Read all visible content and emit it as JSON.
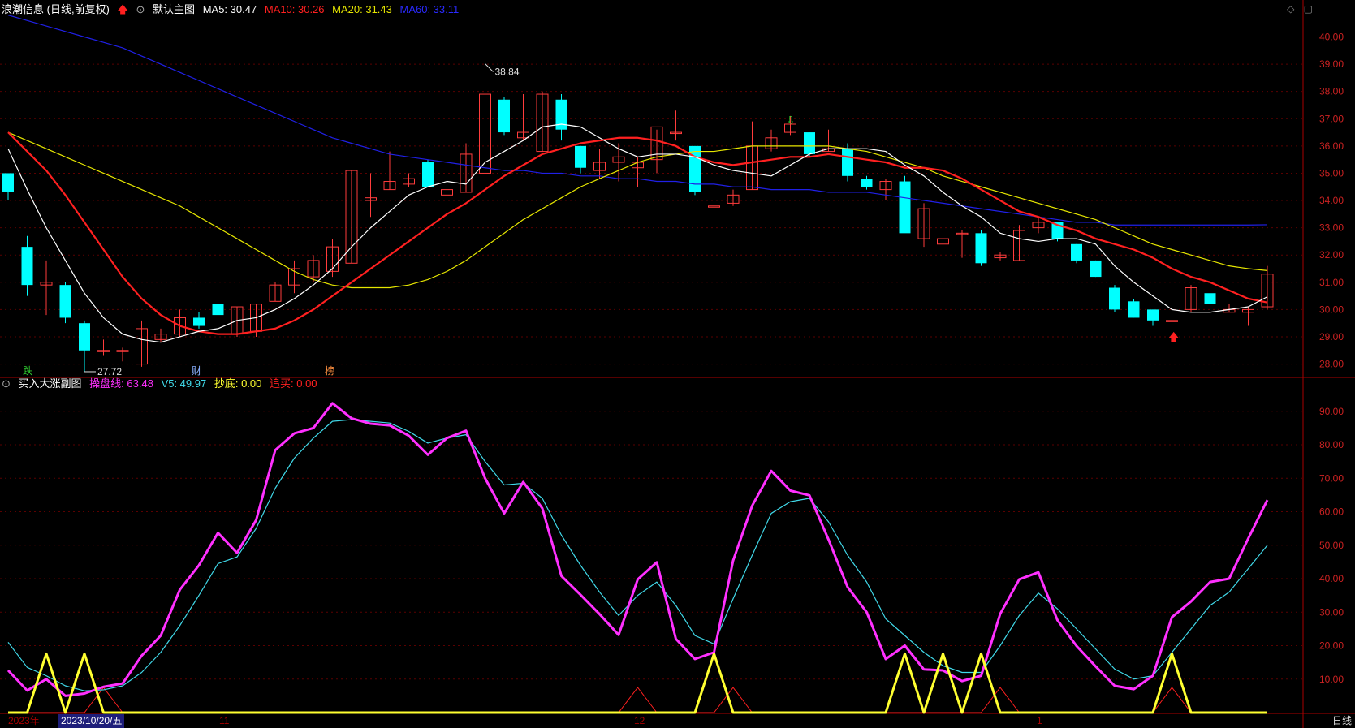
{
  "header": {
    "stock_title": "浪潮信息 (日线,前复权)",
    "main_chart_label": "默认主图",
    "ma5": "MA5: 30.47",
    "ma10": "MA10: 30.26",
    "ma20": "MA20: 31.43",
    "ma60": "MA60: 33.11"
  },
  "sub_header": {
    "title": "买入大涨副图",
    "pan": "操盘线: 63.48",
    "v5": "V5: 49.97",
    "chaodi": "抄底: 0.00",
    "zhuimai": "追买: 0.00"
  },
  "markers": {
    "die": "跌",
    "cai": "财",
    "bang": "榜"
  },
  "annotations": {
    "high": "38.84",
    "low": "27.72"
  },
  "x_axis": {
    "year": "2023年",
    "selected_date": "2023/10/20/五",
    "m11": "11",
    "m12": "12",
    "m1": "1"
  },
  "period_button": "日线",
  "colors": {
    "up": "#ff3c3c",
    "down": "#00ffff",
    "ma5": "#ffffff",
    "ma10": "#ff2020",
    "ma20": "#e6e600",
    "ma60": "#2020e6",
    "pan": "#ff30ff",
    "v5": "#40d8e8",
    "chaodi": "#ffff30",
    "zhuimai": "#ff2020",
    "axis": "#aa0000"
  },
  "chart_data": [
    {
      "type": "candlestick",
      "ylim": [
        27.6,
        40.7
      ],
      "yticks": [
        "28.00",
        "29.00",
        "30.00",
        "31.00",
        "32.00",
        "33.00",
        "34.00",
        "35.00",
        "36.00",
        "37.00",
        "38.00",
        "39.00",
        "40.00"
      ],
      "ohlc": [
        [
          35.0,
          35.0,
          34.0,
          34.3
        ],
        [
          32.3,
          32.7,
          30.5,
          30.9
        ],
        [
          30.9,
          31.8,
          29.8,
          31.0
        ],
        [
          30.9,
          31.0,
          29.5,
          29.7
        ],
        [
          29.5,
          29.6,
          27.72,
          28.5
        ],
        [
          28.5,
          28.9,
          28.3,
          28.5
        ],
        [
          28.5,
          28.6,
          28.1,
          28.5
        ],
        [
          28.0,
          29.6,
          27.9,
          29.3
        ],
        [
          28.9,
          29.3,
          28.8,
          29.1
        ],
        [
          29.1,
          30.0,
          29.0,
          29.7
        ],
        [
          29.7,
          29.9,
          29.3,
          29.4
        ],
        [
          30.2,
          30.9,
          29.8,
          29.8
        ],
        [
          29.1,
          30.1,
          29.0,
          30.1
        ],
        [
          29.2,
          30.2,
          29.0,
          30.2
        ],
        [
          30.3,
          31.0,
          30.3,
          30.9
        ],
        [
          30.9,
          31.8,
          30.6,
          31.5
        ],
        [
          31.2,
          32.0,
          31.0,
          31.8
        ],
        [
          31.4,
          32.6,
          31.2,
          32.3
        ],
        [
          31.7,
          35.1,
          31.7,
          35.1
        ],
        [
          34.0,
          35.0,
          33.4,
          34.1
        ],
        [
          34.4,
          35.8,
          34.4,
          34.7
        ],
        [
          34.6,
          35.0,
          34.5,
          34.8
        ],
        [
          35.4,
          35.5,
          34.5,
          34.5
        ],
        [
          34.2,
          34.3,
          34.1,
          34.4
        ],
        [
          34.3,
          36.1,
          34.3,
          35.7
        ],
        [
          35.0,
          38.84,
          34.8,
          37.9
        ],
        [
          37.7,
          37.8,
          36.4,
          36.5
        ],
        [
          36.3,
          37.9,
          36.2,
          36.5
        ],
        [
          35.8,
          38.0,
          35.8,
          37.9
        ],
        [
          37.7,
          37.9,
          36.2,
          36.6
        ],
        [
          36.0,
          36.0,
          35.0,
          35.2
        ],
        [
          35.1,
          35.9,
          34.8,
          35.4
        ],
        [
          35.4,
          36.1,
          34.7,
          35.6
        ],
        [
          35.2,
          35.6,
          34.5,
          35.4
        ],
        [
          35.5,
          36.6,
          35.0,
          36.7
        ],
        [
          36.5,
          37.3,
          36.2,
          36.5
        ],
        [
          36.0,
          36.0,
          34.2,
          34.3
        ],
        [
          33.8,
          34.4,
          33.5,
          33.8
        ],
        [
          33.9,
          34.4,
          33.8,
          34.2
        ],
        [
          34.4,
          36.9,
          34.4,
          36.0
        ],
        [
          35.9,
          36.6,
          35.8,
          36.3
        ],
        [
          36.5,
          37.1,
          36.4,
          36.8
        ],
        [
          36.5,
          36.5,
          35.6,
          35.7
        ],
        [
          35.8,
          36.6,
          35.8,
          35.9
        ],
        [
          35.9,
          36.1,
          34.7,
          34.9
        ],
        [
          34.8,
          34.9,
          34.4,
          34.5
        ],
        [
          34.4,
          34.8,
          34.0,
          34.7
        ],
        [
          34.7,
          34.9,
          32.9,
          32.8
        ],
        [
          32.6,
          33.9,
          32.3,
          33.7
        ],
        [
          32.4,
          33.8,
          32.3,
          32.6
        ],
        [
          32.8,
          32.9,
          31.9,
          32.8
        ],
        [
          32.8,
          32.9,
          31.6,
          31.7
        ],
        [
          31.9,
          32.1,
          31.8,
          32.0
        ],
        [
          31.8,
          33.1,
          31.8,
          32.9
        ],
        [
          33.0,
          33.4,
          32.8,
          33.2
        ],
        [
          33.2,
          33.2,
          32.5,
          32.6
        ],
        [
          32.4,
          32.4,
          31.7,
          31.8
        ],
        [
          31.8,
          31.8,
          31.2,
          31.2
        ],
        [
          30.8,
          30.9,
          29.9,
          30.0
        ],
        [
          30.3,
          30.4,
          29.7,
          29.7
        ],
        [
          30.0,
          30.0,
          29.4,
          29.6
        ],
        [
          29.6,
          29.7,
          28.8,
          29.6
        ],
        [
          30.0,
          30.9,
          29.9,
          30.8
        ],
        [
          30.6,
          31.6,
          30.1,
          30.2
        ],
        [
          29.9,
          30.2,
          29.9,
          30.0
        ],
        [
          29.9,
          30.1,
          29.4,
          30.0
        ],
        [
          30.1,
          31.6,
          30.0,
          31.3
        ]
      ],
      "ma5": [
        35.9,
        34.4,
        33.0,
        31.8,
        30.6,
        29.7,
        29.1,
        28.9,
        28.8,
        29.0,
        29.2,
        29.3,
        29.6,
        29.7,
        30.0,
        30.4,
        30.9,
        31.5,
        32.3,
        33.0,
        33.6,
        34.2,
        34.5,
        34.7,
        34.6,
        35.4,
        35.8,
        36.2,
        36.7,
        36.8,
        36.7,
        36.3,
        35.9,
        35.6,
        35.7,
        35.7,
        35.6,
        35.3,
        35.1,
        35.0,
        34.9,
        35.3,
        35.7,
        35.9,
        35.9,
        35.9,
        35.8,
        35.3,
        34.9,
        34.3,
        33.8,
        33.4,
        32.8,
        32.6,
        32.5,
        32.6,
        32.6,
        32.4,
        31.6,
        31.0,
        30.5,
        30.0,
        29.9,
        29.9,
        30.0,
        30.1,
        30.47
      ],
      "ma10": [
        36.5,
        35.8,
        35.1,
        34.2,
        33.2,
        32.2,
        31.2,
        30.4,
        29.8,
        29.4,
        29.2,
        29.1,
        29.1,
        29.2,
        29.3,
        29.6,
        30.0,
        30.5,
        31.0,
        31.5,
        32.0,
        32.5,
        33.0,
        33.5,
        33.9,
        34.4,
        34.9,
        35.3,
        35.7,
        35.9,
        36.1,
        36.2,
        36.3,
        36.3,
        36.2,
        36.0,
        35.6,
        35.4,
        35.3,
        35.4,
        35.5,
        35.6,
        35.6,
        35.7,
        35.6,
        35.5,
        35.4,
        35.2,
        35.2,
        35.1,
        34.8,
        34.4,
        34.0,
        33.6,
        33.4,
        33.1,
        32.9,
        32.6,
        32.4,
        32.2,
        31.9,
        31.5,
        31.2,
        31.0,
        30.7,
        30.4,
        30.26
      ],
      "ma20": [
        36.5,
        36.2,
        35.9,
        35.6,
        35.3,
        35.0,
        34.7,
        34.4,
        34.1,
        33.8,
        33.4,
        33.0,
        32.6,
        32.2,
        31.8,
        31.4,
        31.1,
        30.9,
        30.8,
        30.8,
        30.8,
        30.9,
        31.1,
        31.4,
        31.8,
        32.3,
        32.8,
        33.3,
        33.7,
        34.1,
        34.5,
        34.8,
        35.1,
        35.4,
        35.6,
        35.7,
        35.8,
        35.8,
        35.9,
        36.0,
        36.0,
        36.0,
        36.0,
        36.0,
        35.9,
        35.8,
        35.6,
        35.4,
        35.2,
        34.9,
        34.7,
        34.5,
        34.3,
        34.1,
        33.9,
        33.7,
        33.5,
        33.3,
        33.0,
        32.7,
        32.4,
        32.2,
        32.0,
        31.8,
        31.6,
        31.5,
        31.43
      ],
      "ma60": [
        40.8,
        40.6,
        40.4,
        40.2,
        40.0,
        39.8,
        39.6,
        39.3,
        39.0,
        38.7,
        38.4,
        38.1,
        37.8,
        37.5,
        37.2,
        36.9,
        36.6,
        36.3,
        36.1,
        35.9,
        35.7,
        35.6,
        35.5,
        35.4,
        35.3,
        35.2,
        35.1,
        35.1,
        35.0,
        35.0,
        34.9,
        34.9,
        34.8,
        34.8,
        34.7,
        34.7,
        34.6,
        34.6,
        34.5,
        34.5,
        34.4,
        34.4,
        34.4,
        34.3,
        34.3,
        34.3,
        34.2,
        34.1,
        34.0,
        33.9,
        33.8,
        33.7,
        33.6,
        33.5,
        33.4,
        33.3,
        33.2,
        33.2,
        33.1,
        33.1,
        33.1,
        33.1,
        33.1,
        33.1,
        33.1,
        33.1,
        33.11
      ]
    },
    {
      "type": "line",
      "ylim": [
        0,
        96
      ],
      "yticks": [
        "10.00",
        "20.00",
        "30.00",
        "40.00",
        "50.00",
        "60.00",
        "70.00",
        "80.00",
        "90.00"
      ],
      "series": [
        {
          "name": "操盘线",
          "values": [
            12.6,
            6.6,
            10.0,
            5.0,
            5.7,
            7.7,
            8.7,
            17.0,
            23.0,
            36.7,
            44.0,
            53.7,
            47.7,
            57.5,
            78.4,
            83.4,
            85.0,
            92.4,
            87.9,
            86.3,
            85.8,
            82.7,
            77.0,
            82.0,
            84.2,
            70.0,
            59.5,
            68.9,
            61.0,
            40.8,
            35.2,
            29.4,
            23.2,
            39.8,
            44.9,
            22.0,
            16.0,
            18.0,
            45.4,
            61.8,
            72.2,
            66.3,
            64.9,
            51.7,
            37.5,
            30.0,
            16.0,
            20.0,
            12.9,
            12.6,
            9.4,
            11.0,
            29.5,
            39.8,
            41.9,
            27.6,
            19.9,
            13.8,
            8.0,
            7.0,
            11.0,
            28.5,
            33.2,
            39.0,
            40.0,
            52.0,
            63.48
          ]
        },
        {
          "name": "V5",
          "values": [
            21.0,
            13.5,
            11.0,
            8.0,
            6.5,
            6.8,
            8.0,
            12.0,
            18.0,
            26.0,
            35.0,
            44.5,
            46.5,
            55.0,
            67.0,
            76.0,
            82.0,
            87.0,
            87.5,
            87.0,
            86.5,
            84.0,
            80.5,
            82.0,
            83.0,
            75.0,
            68.0,
            68.5,
            64.0,
            53.0,
            44.0,
            36.0,
            29.0,
            35.0,
            39.0,
            32.0,
            23.0,
            20.5,
            34.0,
            47.0,
            59.5,
            63.0,
            64.0,
            57.0,
            47.0,
            39.0,
            28.0,
            23.0,
            18.0,
            14.0,
            12.0,
            12.0,
            20.0,
            29.0,
            35.7,
            31.0,
            25.0,
            19.0,
            13.0,
            10.0,
            11.0,
            18.0,
            25.0,
            32.0,
            36.0,
            43.0,
            49.97
          ]
        },
        {
          "name": "抄底",
          "values": [
            0,
            0,
            17.6,
            0,
            17.6,
            0,
            0,
            0,
            0,
            0,
            0,
            0,
            0,
            0,
            0,
            0,
            0,
            0,
            0,
            0,
            0,
            0,
            0,
            0,
            0,
            0,
            0,
            0,
            0,
            0,
            0,
            0,
            0,
            0,
            0,
            0,
            0,
            17.6,
            0,
            0,
            0,
            0,
            0,
            0,
            0,
            0,
            0,
            17.6,
            0,
            17.6,
            0,
            17.6,
            0,
            0,
            0,
            0,
            0,
            0,
            0,
            0,
            0,
            17.6,
            0,
            0,
            0,
            0,
            0
          ]
        },
        {
          "name": "追买",
          "values": [
            0,
            0,
            0,
            0,
            0,
            7.5,
            0,
            0,
            0,
            0,
            0,
            0,
            0,
            0,
            0,
            0,
            0,
            0,
            0,
            0,
            0,
            0,
            0,
            0,
            0,
            0,
            0,
            0,
            0,
            0,
            0,
            0,
            0,
            7.5,
            0,
            0,
            0,
            0,
            7.5,
            0,
            0,
            0,
            0,
            0,
            0,
            0,
            0,
            0,
            0,
            0,
            0,
            0,
            7.5,
            0,
            0,
            0,
            0,
            0,
            0,
            0,
            0,
            7.5,
            0,
            0,
            0,
            0,
            0
          ]
        }
      ]
    }
  ]
}
